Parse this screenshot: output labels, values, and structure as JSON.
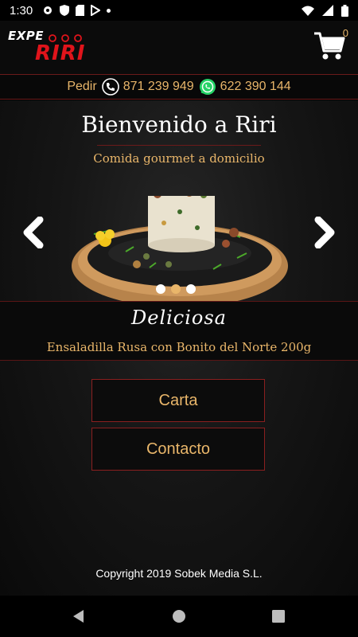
{
  "status_bar": {
    "time": "1:30"
  },
  "app_bar": {
    "logo_top": "EXPE",
    "logo_main": "RIRI",
    "cart_count": "0"
  },
  "contact_bar": {
    "order_label": "Pedir",
    "phone": "871 239 949",
    "whatsapp": "622 390 144"
  },
  "hero": {
    "title": "Bienvenido a Riri",
    "subtitle": "Comida gourmet a domicilio",
    "slide_count": 3,
    "active_slide": 2
  },
  "caption": {
    "tagline": "Deliciosa",
    "product": "Ensaladilla Rusa con Bonito del Norte 200g"
  },
  "buttons": {
    "carta": "Carta",
    "contacto": "Contacto"
  },
  "footer": {
    "copyright": "Copyright 2019 Sobek Media S.L."
  },
  "colors": {
    "accent": "#e9b66a",
    "border": "#8a1f1f",
    "brand_red": "#e0141b",
    "whatsapp_green": "#25d366"
  }
}
